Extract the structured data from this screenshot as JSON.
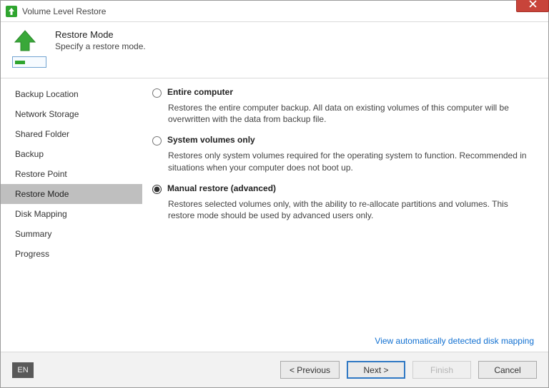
{
  "window": {
    "title": "Volume Level Restore"
  },
  "header": {
    "title": "Restore Mode",
    "subtitle": "Specify a restore mode."
  },
  "sidebar": {
    "items": [
      {
        "label": "Backup Location"
      },
      {
        "label": "Network Storage"
      },
      {
        "label": "Shared Folder"
      },
      {
        "label": "Backup"
      },
      {
        "label": "Restore Point"
      },
      {
        "label": "Restore Mode"
      },
      {
        "label": "Disk Mapping"
      },
      {
        "label": "Summary"
      },
      {
        "label": "Progress"
      }
    ],
    "activeIndex": 5
  },
  "options": [
    {
      "label": "Entire computer",
      "desc": "Restores the entire computer backup. All data on existing volumes of this computer will be overwritten with the data from backup file.",
      "selected": false
    },
    {
      "label": "System volumes only",
      "desc": "Restores only system volumes required for the operating system to function. Recommended in situations when your computer does not boot up.",
      "selected": false
    },
    {
      "label": "Manual restore (advanced)",
      "desc": "Restores selected volumes only, with the ability to re-allocate partitions and volumes. This restore mode should be used by advanced users only.",
      "selected": true
    }
  ],
  "link": {
    "label": "View automatically detected disk mapping"
  },
  "footer": {
    "lang": "EN",
    "buttons": {
      "previous": "< Previous",
      "next": "Next >",
      "finish": "Finish",
      "cancel": "Cancel"
    }
  }
}
